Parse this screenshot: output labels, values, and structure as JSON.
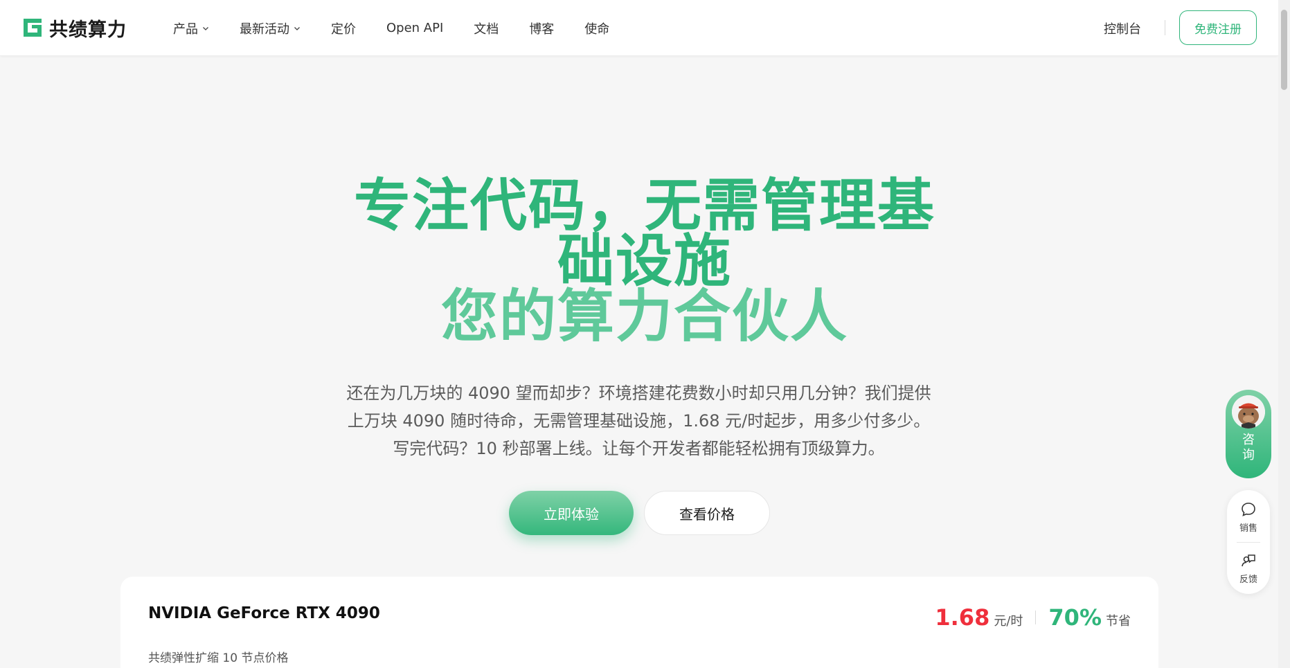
{
  "header": {
    "logo_text": "共绩算力",
    "nav": [
      {
        "label": "产品",
        "has_dropdown": true
      },
      {
        "label": "最新活动",
        "has_dropdown": true
      },
      {
        "label": "定价",
        "has_dropdown": false
      },
      {
        "label": "Open API",
        "has_dropdown": false
      },
      {
        "label": "文档",
        "has_dropdown": false
      },
      {
        "label": "博客",
        "has_dropdown": false
      },
      {
        "label": "使命",
        "has_dropdown": false
      }
    ],
    "console_label": "控制台",
    "register_label": "免费注册"
  },
  "hero": {
    "title_line1": "专注代码，无需管理基",
    "title_line2": "础设施",
    "title_line3": "您的算力合伙人",
    "description": "还在为几万块的 4090 望而却步？环境搭建花费数小时却只用几分钟？我们提供上万块 4090 随时待命，无需管理基础设施，1.68 元/时起步，用多少付多少。写完代码？10 秒部署上线。让每个开发者都能轻松拥有顶级算力。",
    "primary_button": "立即体验",
    "secondary_button": "查看价格"
  },
  "card": {
    "title": "NVIDIA GeForce RTX 4090",
    "subtitle": "共绩弹性扩缩 10 节点价格",
    "price": "1.68",
    "price_unit": "元/时",
    "saving": "70%",
    "saving_label": "节省"
  },
  "side": {
    "consult_label": "咨询",
    "sales_label": "销售",
    "feedback_label": "反馈"
  },
  "colors": {
    "brand_green": "#2fb57a",
    "price_red": "#ef2f3c"
  }
}
